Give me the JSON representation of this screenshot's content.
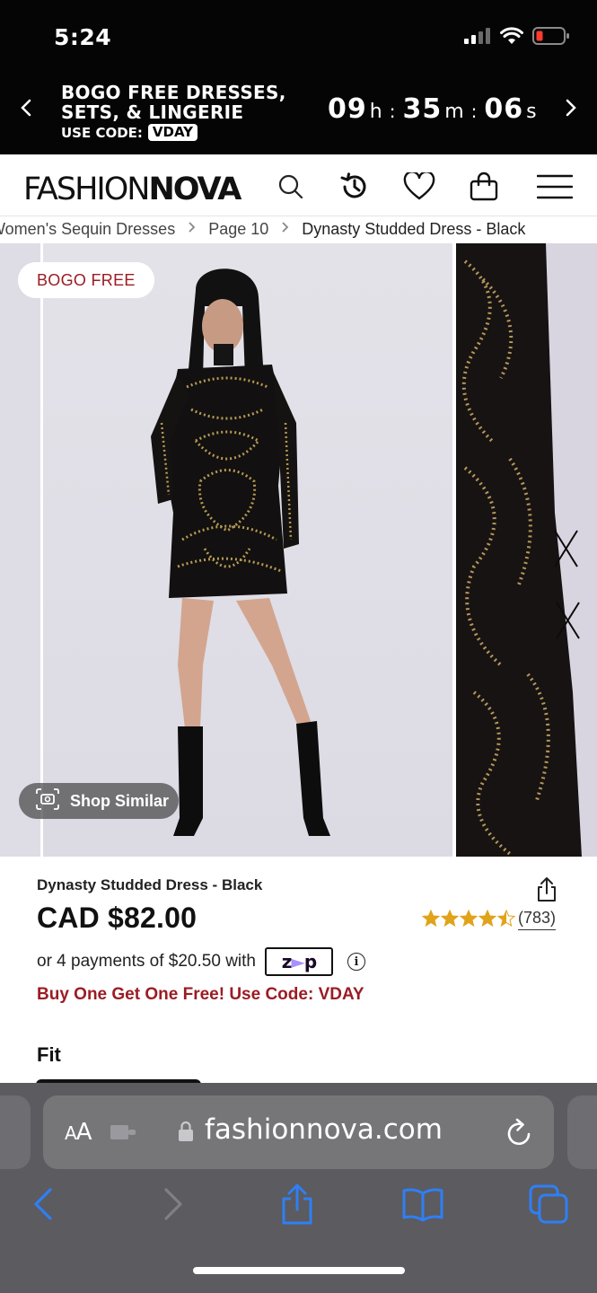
{
  "status_bar": {
    "time": "5:24",
    "icons": [
      "signal-icon",
      "wifi-icon",
      "battery-low-icon"
    ]
  },
  "promo": {
    "line1": "BOGO FREE DRESSES,",
    "line2": "SETS, & LINGERIE",
    "code_label": "USE CODE:",
    "code": "VDAY",
    "countdown": {
      "hours": "09",
      "h_unit": "h",
      "minutes": "35",
      "m_unit": "m",
      "seconds": "06",
      "s_unit": "s",
      "sep": ":"
    }
  },
  "header": {
    "logo_light": "FASHION",
    "logo_bold": "NOVA",
    "icons": [
      "search-icon",
      "history-icon",
      "heart-icon",
      "bag-icon",
      "menu-icon"
    ]
  },
  "breadcrumb": {
    "items": [
      "Women's Sequin Dresses",
      "Page 10",
      "Dynasty Studded Dress - Black"
    ],
    "separator": ">"
  },
  "gallery": {
    "badge": "BOGO FREE",
    "shop_similar": "Shop Similar"
  },
  "product": {
    "title": "Dynasty Studded Dress - Black",
    "price": "CAD $82.00",
    "rating": 4.5,
    "review_count": "(783)",
    "installments_text": "or 4 payments of $20.50 with",
    "zip_logo": "zip",
    "promo_line": "Buy One Get One Free! Use Code: VDAY",
    "fit_label": "Fit"
  },
  "browser": {
    "aa": "AA",
    "url": "fashionnova.com",
    "toolbar": [
      "back-icon",
      "forward-icon",
      "share-icon",
      "bookmarks-icon",
      "tabs-icon"
    ]
  },
  "colors": {
    "brand_red": "#9b1c24",
    "promo_bg": "#050505",
    "star": "#e0a31a",
    "ios_blue": "#2f7ff5",
    "safari_bg": "#5b5b60"
  }
}
